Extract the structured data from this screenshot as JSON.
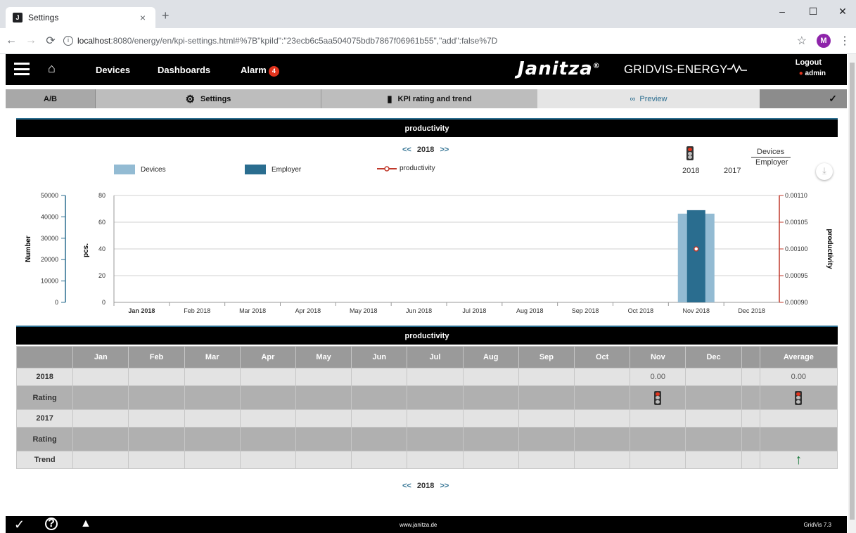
{
  "browser": {
    "tab_title": "Settings",
    "tab_favicon": "J",
    "url_host": "localhost",
    "url_rest": ":8080/energy/en/kpi-settings.html#%7B\"kpiId\":\"23ecb6c5aa504075bdb7867f06961b55\",\"add\":false%7D",
    "profile_initial": "M"
  },
  "header": {
    "nav": [
      "Devices",
      "Dashboards",
      "Alarm"
    ],
    "alarm_count": "4",
    "brand": "Janitza",
    "brand_reg": "®",
    "brand_sub": "GRIDVIS-ENERGY",
    "logout": "Logout",
    "user": "admin"
  },
  "subnav": {
    "ab": "A/B",
    "settings": "Settings",
    "kpi": "KPI rating and trend",
    "preview": "Preview"
  },
  "chart_panel": {
    "title": "productivity",
    "year": "2018",
    "prev": "<<",
    "next": ">>",
    "legend": [
      "Devices",
      "Employer",
      "productivity"
    ],
    "right_legend_num": "Devices",
    "right_legend_den": "Employer",
    "years": [
      "2018",
      "2017"
    ]
  },
  "chart_data": {
    "type": "bar",
    "categories": [
      "Jan 2018",
      "Feb 2018",
      "Mar 2018",
      "Apr 2018",
      "May 2018",
      "Jun 2018",
      "Jul 2018",
      "Aug 2018",
      "Sep 2018",
      "Oct 2018",
      "Nov 2018",
      "Dec 2018"
    ],
    "series": [
      {
        "name": "Devices",
        "axis": "Number",
        "values": [
          null,
          null,
          null,
          null,
          null,
          null,
          null,
          null,
          null,
          null,
          41500,
          null
        ]
      },
      {
        "name": "Employer",
        "axis": "pcs.",
        "values": [
          null,
          null,
          null,
          null,
          null,
          null,
          null,
          null,
          null,
          null,
          69,
          null
        ]
      },
      {
        "name": "productivity",
        "axis": "productivity",
        "values": [
          null,
          null,
          null,
          null,
          null,
          null,
          null,
          null,
          null,
          null,
          0.001,
          null
        ]
      }
    ],
    "axes": {
      "number": {
        "label": "Number",
        "range": [
          0,
          50000
        ],
        "ticks": [
          "0",
          "10000",
          "20000",
          "30000",
          "40000",
          "50000"
        ]
      },
      "pcs": {
        "label": "pcs.",
        "range": [
          0,
          80
        ],
        "ticks": [
          "0",
          "20",
          "40",
          "60",
          "80"
        ]
      },
      "productivity": {
        "label": "productivity",
        "range": [
          0.0009,
          0.0011
        ],
        "ticks": [
          "0.00090",
          "0.00095",
          "0.00100",
          "0.00105",
          "0.00110"
        ]
      }
    },
    "colors": {
      "devices": "#93bbd3",
      "employer": "#2a6d8f",
      "productivity": "#c0392b"
    },
    "grid": true
  },
  "table": {
    "title": "productivity",
    "months": [
      "Jan",
      "Feb",
      "Mar",
      "Apr",
      "May",
      "Jun",
      "Jul",
      "Aug",
      "Sep",
      "Oct",
      "Nov",
      "Dec"
    ],
    "average_label": "Average",
    "rows": [
      "2018",
      "Rating",
      "2017",
      "Rating",
      "Trend"
    ],
    "nov_2018": "0.00",
    "avg_2018": "0.00"
  },
  "footer": {
    "site": "www.janitza.de",
    "version": "GridVis 7.3"
  }
}
